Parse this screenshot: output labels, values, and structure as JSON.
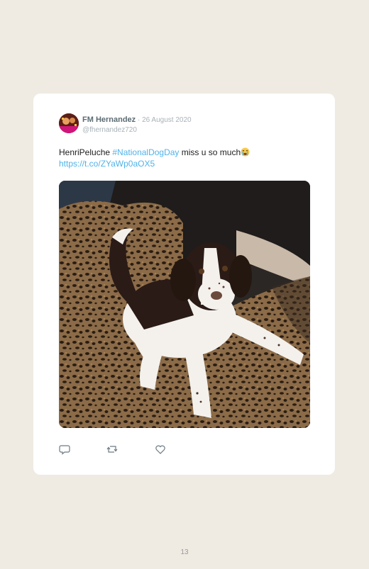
{
  "tweet": {
    "author_name": "FM Hernandez",
    "separator": " · ",
    "date": "26 August 2020",
    "handle": "@fhernandez720",
    "text_prefix": "HenriPeluche ",
    "hashtag": "#NationalDogDay",
    "text_suffix": " miss u so much",
    "emoji": "crying-face-emoji",
    "link": "https://t.co/ZYaWp0aOX5",
    "image": "photo of a black-and-white puppy lying on a leopard-print couch cover"
  },
  "actions": {
    "reply_icon": "reply-icon",
    "retweet_icon": "retweet-icon",
    "like_icon": "heart-icon"
  },
  "page": {
    "number": "13"
  },
  "colors": {
    "page_background": "#efebe3",
    "card_background": "#ffffff",
    "link_blue": "#4fb3e8",
    "name_gray": "#5b6b73",
    "meta_gray": "#a8b2b8"
  }
}
